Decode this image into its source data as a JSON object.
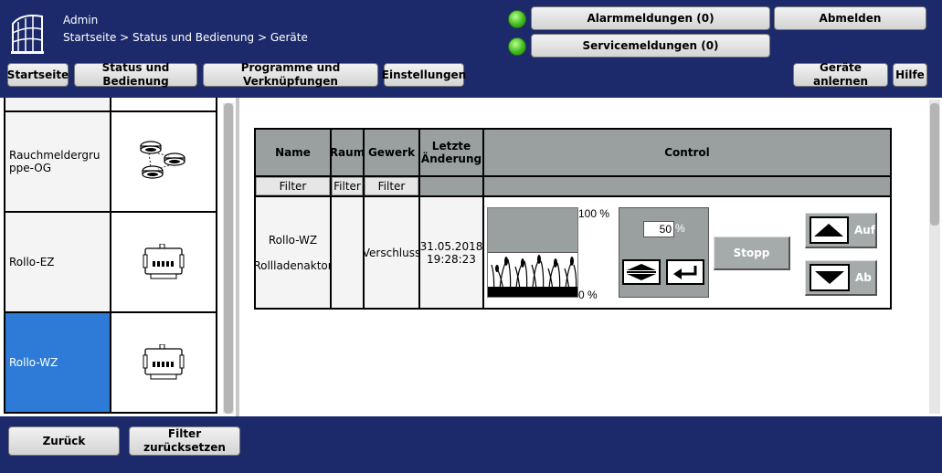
{
  "header": {
    "user": "Admin",
    "breadcrumb": "Startseite > Status und Bedienung > Geräte",
    "alarm_button": "Alarmmeldungen (0)",
    "service_button": "Servicemeldungen (0)",
    "logout_button": "Abmelden",
    "status_colors": {
      "ok": "#39b51a"
    }
  },
  "nav": {
    "items": [
      "Startseite",
      "Status und Bedienung",
      "Programme und Verknüpfungen",
      "Einstellungen"
    ],
    "teach_button": "Geräte anlernen",
    "help_button": "Hilfe"
  },
  "device_list": {
    "items": [
      {
        "name": "Rauchmeldergruppe-OG",
        "icon": "smoke-detector-group-icon",
        "selected": false
      },
      {
        "name": "Rollo-EZ",
        "icon": "shutter-actuator-icon",
        "selected": false
      },
      {
        "name": "Rollo-WZ",
        "icon": "shutter-actuator-icon",
        "selected": true
      }
    ],
    "selected_color": "#2d7bd6"
  },
  "table": {
    "columns": [
      "Name",
      "Raum",
      "Gewerk",
      "Letzte Änderung",
      "Control"
    ],
    "filter_labels": [
      "Filter",
      "Filter",
      "Filter"
    ],
    "row": {
      "name": "Rollo-WZ",
      "type": "Rollladenaktor",
      "room": "",
      "trade": "Verschluss",
      "date": "31.05.2018",
      "time": "19:28:23"
    }
  },
  "control": {
    "top_label": "100 %",
    "bottom_label": "0 %",
    "level_value": "50",
    "level_unit": "%",
    "level_fraction": 0.5,
    "stop_button": "Stopp",
    "up_button": "Auf",
    "down_button": "Ab"
  },
  "footer": {
    "back_button": "Zurück",
    "reset_button": "Filter zurücksetzen"
  }
}
